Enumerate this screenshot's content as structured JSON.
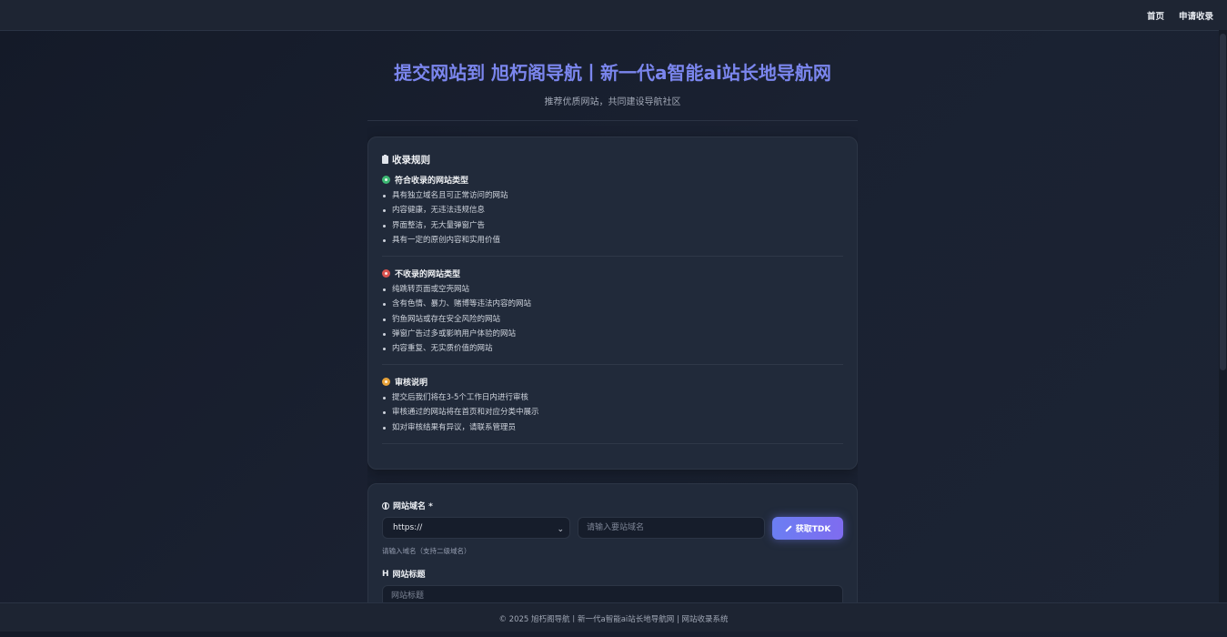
{
  "nav": {
    "home_label": "首页",
    "submit_label": "申请收录"
  },
  "header": {
    "title": "提交网站到 旭朽阁导航丨新一代a智能ai站长地导航网",
    "subtitle": "推荐优质网站，共同建设导航社区"
  },
  "rules": {
    "heading": "收录规则",
    "accepted": {
      "title": "符合收录的网站类型",
      "items": [
        "具有独立域名且可正常访问的网站",
        "内容健康，无违法违规信息",
        "界面整洁，无大量弹窗广告",
        "具有一定的原创内容和实用价值"
      ]
    },
    "rejected": {
      "title": "不收录的网站类型",
      "items": [
        "纯跳转页面或空壳网站",
        "含有色情、暴力、赌博等违法内容的网站",
        "钓鱼网站或存在安全风险的网站",
        "弹窗广告过多或影响用户体验的网站",
        "内容重复、无实质价值的网站"
      ]
    },
    "review": {
      "title": "审核说明",
      "items": [
        "提交后我们将在3-5个工作日内进行审核",
        "审核通过的网站将在首页和对应分类中展示",
        "如对审核结果有异议，请联系管理员"
      ]
    }
  },
  "form": {
    "domain_label": "网站域名 *",
    "protocol_value": "https://",
    "domain_placeholder": "请输入要站域名",
    "tdk_button": "获取TDK",
    "domain_hint": "请输入域名（支持二级域名）",
    "title_label": "网站标题",
    "title_placeholder": "网站标题"
  },
  "footer": {
    "text": "© 2025 旭朽阁导航丨新一代a智能ai站长地导航网 | 网站收录系统"
  },
  "colors": {
    "accent": "#7b86ee",
    "accepted": "#3db873",
    "rejected": "#d9534f",
    "review": "#e8a33a"
  }
}
